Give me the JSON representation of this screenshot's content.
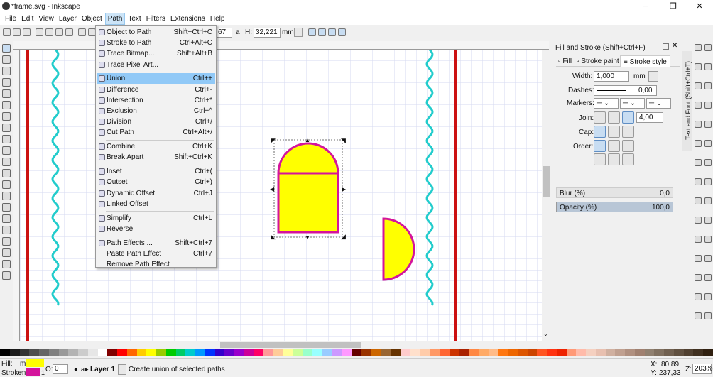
{
  "window": {
    "title": "*frame.svg - Inkscape",
    "minimize": "─",
    "maximize": "❐",
    "close": "✕"
  },
  "menubar": [
    "File",
    "Edit",
    "View",
    "Layer",
    "Object",
    "Path",
    "Text",
    "Filters",
    "Extensions",
    "Help"
  ],
  "active_menu": "Path",
  "toolbar": {
    "w_partial": "67",
    "h_label": "H:",
    "h_value": "32,221",
    "unit": "mm",
    "lock": "a"
  },
  "path_menu": {
    "items": [
      {
        "label": "Object to Path",
        "shortcut": "Shift+Ctrl+C",
        "icon": "object-to-path-icon"
      },
      {
        "label": "Stroke to Path",
        "shortcut": "Ctrl+Alt+C",
        "icon": "stroke-to-path-icon"
      },
      {
        "label": "Trace Bitmap...",
        "shortcut": "Shift+Alt+B",
        "icon": "trace-bitmap-icon"
      },
      {
        "label": "Trace Pixel Art...",
        "shortcut": "",
        "icon": "trace-pixel-art-icon"
      },
      {
        "sep": true
      },
      {
        "label": "Union",
        "shortcut": "Ctrl++",
        "icon": "union-icon",
        "highlight": true
      },
      {
        "label": "Difference",
        "shortcut": "Ctrl+-",
        "icon": "difference-icon"
      },
      {
        "label": "Intersection",
        "shortcut": "Ctrl+*",
        "icon": "intersection-icon"
      },
      {
        "label": "Exclusion",
        "shortcut": "Ctrl+^",
        "icon": "exclusion-icon"
      },
      {
        "label": "Division",
        "shortcut": "Ctrl+/",
        "icon": "division-icon"
      },
      {
        "label": "Cut Path",
        "shortcut": "Ctrl+Alt+/",
        "icon": "cut-path-icon"
      },
      {
        "sep": true
      },
      {
        "label": "Combine",
        "shortcut": "Ctrl+K",
        "icon": "combine-icon"
      },
      {
        "label": "Break Apart",
        "shortcut": "Shift+Ctrl+K",
        "icon": "break-apart-icon"
      },
      {
        "sep": true
      },
      {
        "label": "Inset",
        "shortcut": "Ctrl+(",
        "icon": "inset-icon"
      },
      {
        "label": "Outset",
        "shortcut": "Ctrl+)",
        "icon": "outset-icon"
      },
      {
        "label": "Dynamic Offset",
        "shortcut": "Ctrl+J",
        "icon": "dynamic-offset-icon"
      },
      {
        "label": "Linked Offset",
        "shortcut": "",
        "icon": "linked-offset-icon"
      },
      {
        "sep": true
      },
      {
        "label": "Simplify",
        "shortcut": "Ctrl+L",
        "icon": "simplify-icon"
      },
      {
        "label": "Reverse",
        "shortcut": "",
        "icon": "reverse-icon"
      },
      {
        "sep": true
      },
      {
        "label": "Path Effects ...",
        "shortcut": "Shift+Ctrl+7",
        "icon": "path-effects-icon"
      },
      {
        "label": "Paste Path Effect",
        "shortcut": "Ctrl+7",
        "icon": ""
      },
      {
        "label": "Remove Path Effect",
        "shortcut": "",
        "icon": ""
      }
    ]
  },
  "dock": {
    "title": "Fill and Stroke (Shift+Ctrl+F)",
    "side_tab": "Text and Font (Shift+Ctrl+T)",
    "tabs": [
      "Fill",
      "Stroke paint",
      "Stroke style"
    ],
    "width_label": "Width:",
    "width_value": "1,000",
    "width_unit": "mm",
    "dashes_label": "Dashes:",
    "dashes_value": "0,00",
    "markers_label": "Markers:",
    "join_label": "Join:",
    "join_value": "4,00",
    "cap_label": "Cap:",
    "order_label": "Order:",
    "blur_label": "Blur (%)",
    "blur_value": "0,0",
    "opacity_label": "Opacity (%)",
    "opacity_value": "100,0"
  },
  "status": {
    "fill_label": "Fill:",
    "stroke_label": "Stroke:",
    "fill_code": "m",
    "stroke_code": "m",
    "stroke_width": "1",
    "opacity_label": "O:",
    "opacity_value": "0",
    "layer": "Layer 1",
    "message": "Create union of selected paths",
    "x_label": "X:",
    "x_value": "80,89",
    "y_label": "Y:",
    "y_value": "237,33",
    "z_label": "Z:",
    "z_value": "203%"
  },
  "colors": {
    "fill": "#ffff00",
    "stroke": "#d4149c",
    "accent_red": "#cc1111",
    "wave": "#22cccc",
    "highlight": "#91c9f7"
  },
  "palette": [
    "#000000",
    "#1a1a1a",
    "#333333",
    "#4d4d4d",
    "#666666",
    "#808080",
    "#999999",
    "#b3b3b3",
    "#cccccc",
    "#e6e6e6",
    "#ffffff",
    "#800000",
    "#ff0000",
    "#ff6600",
    "#ffcc00",
    "#ffff00",
    "#99cc00",
    "#00cc00",
    "#00cc66",
    "#00cccc",
    "#0099ff",
    "#0033ff",
    "#3300cc",
    "#6600cc",
    "#9900cc",
    "#cc0099",
    "#ff0066",
    "#ff9999",
    "#ffcc99",
    "#ffff99",
    "#ccff99",
    "#99ffcc",
    "#99ffff",
    "#99ccff",
    "#cc99ff",
    "#ff99ff",
    "#660000",
    "#993300",
    "#cc6600",
    "#996633",
    "#663300",
    "#ffcccc",
    "#ffe0cc",
    "#ffccaa",
    "#ff9966",
    "#ff6633",
    "#cc3300",
    "#aa2200",
    "#ff8844",
    "#ffaa66",
    "#ffbb88",
    "#ff7711",
    "#ee6600",
    "#dd5500",
    "#cc4400",
    "#ff5522",
    "#ff3311",
    "#ee2200",
    "#ff9977",
    "#ffbbaa",
    "#f5d0c0",
    "#e8c0b0",
    "#d0b0a0",
    "#c0a090",
    "#b09080",
    "#a08070",
    "#908070",
    "#807060",
    "#706050",
    "#605040",
    "#504030",
    "#403020",
    "#302010"
  ]
}
